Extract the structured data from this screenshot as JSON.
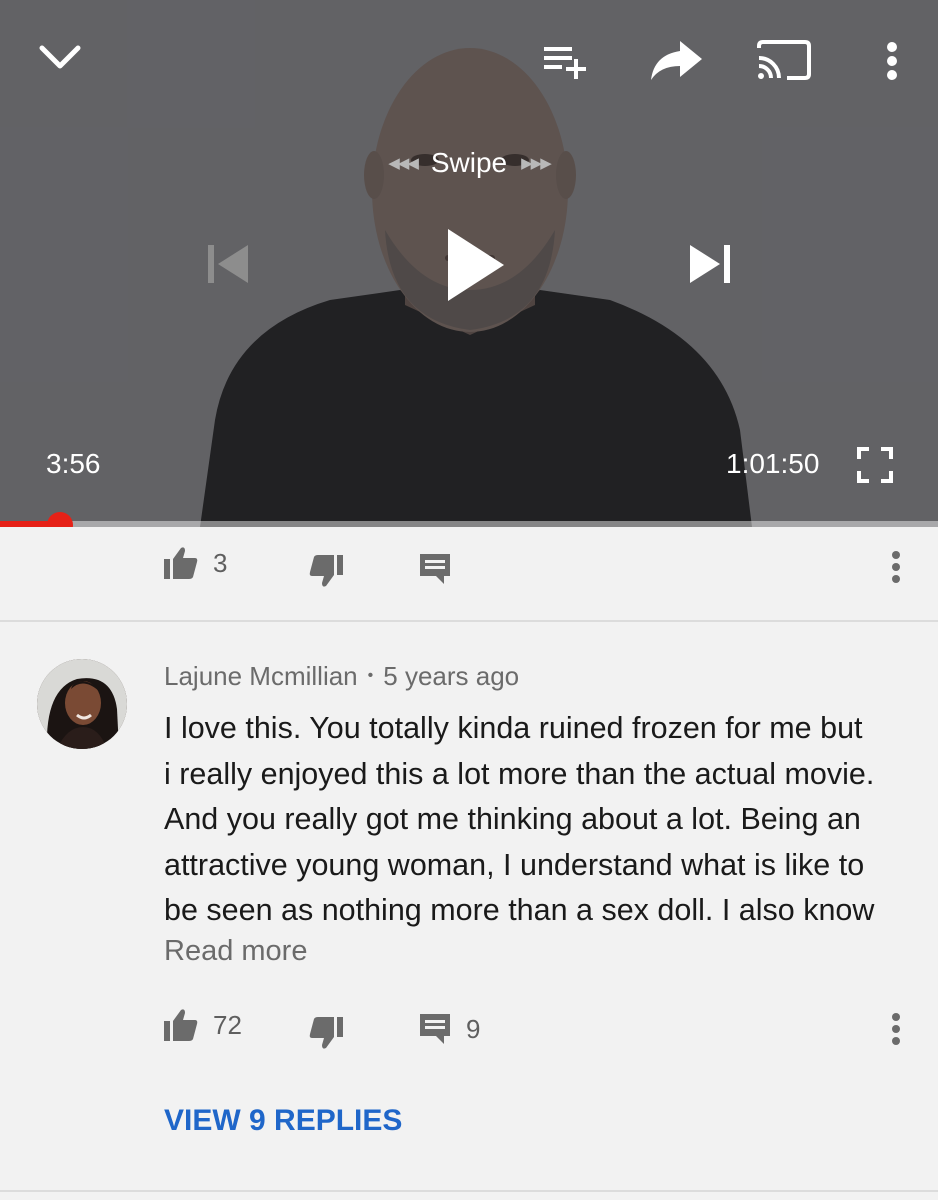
{
  "player": {
    "swipe_label": "Swipe",
    "current_time": "3:56",
    "duration": "1:01:50",
    "progress_fraction": 0.0636,
    "accent_color": "#e62117",
    "icons": [
      "chevron-down-icon",
      "add-to-queue-icon",
      "share-icon",
      "cast-icon",
      "more-vert-icon",
      "previous-icon",
      "play-icon",
      "next-icon",
      "fullscreen-icon"
    ]
  },
  "video_actions": {
    "like_count": "3"
  },
  "comment": {
    "author": "Lajune Mcmillian",
    "separator": "•",
    "time_ago": "5 years ago",
    "lines": [
      "I love this. You totally kinda ruined frozen for me but",
      "i really enjoyed this a lot more than the actual movie.",
      "And you really got me thinking about a lot. Being an",
      "attractive young woman, I understand what is like to",
      "be seen as nothing more than a sex doll. I also know"
    ],
    "read_more": "Read more",
    "like_count": "72",
    "reply_count": "9",
    "view_replies": "VIEW 9 REPLIES"
  }
}
